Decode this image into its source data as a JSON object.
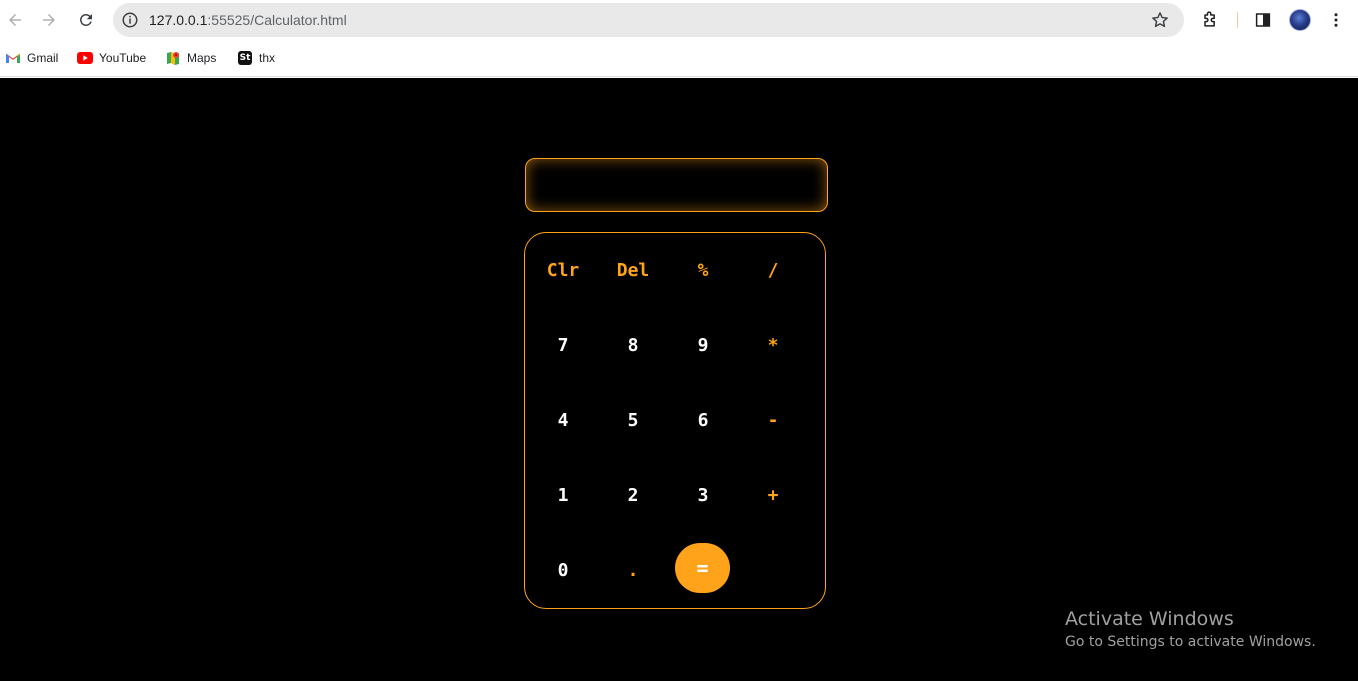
{
  "browser": {
    "url_host": "127.0.0.1",
    "url_rest": ":55525/Calculator.html",
    "bookmarks": [
      {
        "label": "Gmail",
        "icon": "gmail-icon"
      },
      {
        "label": "YouTube",
        "icon": "youtube-icon"
      },
      {
        "label": "Maps",
        "icon": "maps-icon"
      },
      {
        "label": "thx",
        "icon": "st-icon",
        "icon_text": "St"
      }
    ]
  },
  "calculator": {
    "display_value": "",
    "accent_color": "#ffa31a",
    "keys": {
      "clr": "Clr",
      "del": "Del",
      "percent": "%",
      "divide": "/",
      "seven": "7",
      "eight": "8",
      "nine": "9",
      "multiply": "*",
      "four": "4",
      "five": "5",
      "six": "6",
      "minus": "-",
      "one": "1",
      "two": "2",
      "three": "3",
      "plus": "+",
      "zero": "0",
      "dot": ".",
      "equals": "="
    }
  },
  "watermark": {
    "title": "Activate Windows",
    "subtitle": "Go to Settings to activate Windows."
  }
}
